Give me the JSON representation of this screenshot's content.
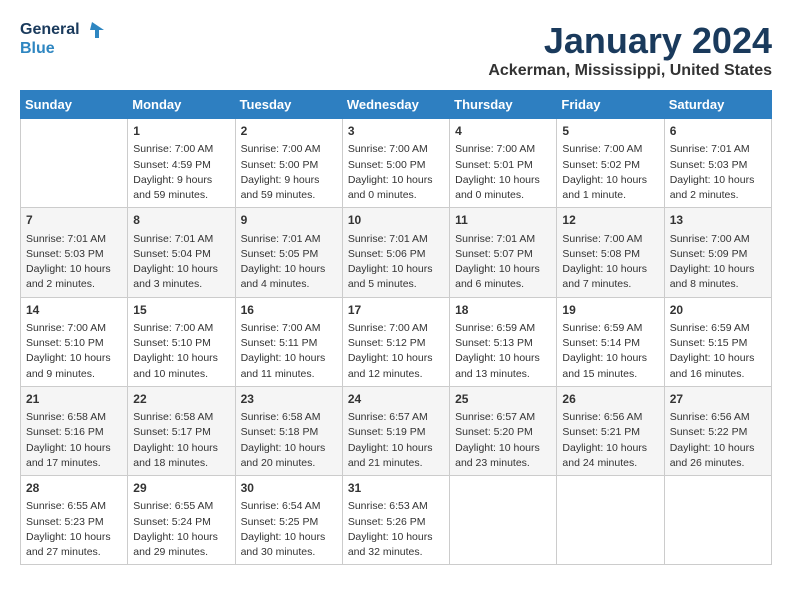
{
  "logo": {
    "text1": "General",
    "text2": "Blue"
  },
  "title": "January 2024",
  "location": "Ackerman, Mississippi, United States",
  "headers": [
    "Sunday",
    "Monday",
    "Tuesday",
    "Wednesday",
    "Thursday",
    "Friday",
    "Saturday"
  ],
  "weeks": [
    [
      {
        "day": "",
        "info": ""
      },
      {
        "day": "1",
        "info": "Sunrise: 7:00 AM\nSunset: 4:59 PM\nDaylight: 9 hours\nand 59 minutes."
      },
      {
        "day": "2",
        "info": "Sunrise: 7:00 AM\nSunset: 5:00 PM\nDaylight: 9 hours\nand 59 minutes."
      },
      {
        "day": "3",
        "info": "Sunrise: 7:00 AM\nSunset: 5:00 PM\nDaylight: 10 hours\nand 0 minutes."
      },
      {
        "day": "4",
        "info": "Sunrise: 7:00 AM\nSunset: 5:01 PM\nDaylight: 10 hours\nand 0 minutes."
      },
      {
        "day": "5",
        "info": "Sunrise: 7:00 AM\nSunset: 5:02 PM\nDaylight: 10 hours\nand 1 minute."
      },
      {
        "day": "6",
        "info": "Sunrise: 7:01 AM\nSunset: 5:03 PM\nDaylight: 10 hours\nand 2 minutes."
      }
    ],
    [
      {
        "day": "7",
        "info": "Sunrise: 7:01 AM\nSunset: 5:03 PM\nDaylight: 10 hours\nand 2 minutes."
      },
      {
        "day": "8",
        "info": "Sunrise: 7:01 AM\nSunset: 5:04 PM\nDaylight: 10 hours\nand 3 minutes."
      },
      {
        "day": "9",
        "info": "Sunrise: 7:01 AM\nSunset: 5:05 PM\nDaylight: 10 hours\nand 4 minutes."
      },
      {
        "day": "10",
        "info": "Sunrise: 7:01 AM\nSunset: 5:06 PM\nDaylight: 10 hours\nand 5 minutes."
      },
      {
        "day": "11",
        "info": "Sunrise: 7:01 AM\nSunset: 5:07 PM\nDaylight: 10 hours\nand 6 minutes."
      },
      {
        "day": "12",
        "info": "Sunrise: 7:00 AM\nSunset: 5:08 PM\nDaylight: 10 hours\nand 7 minutes."
      },
      {
        "day": "13",
        "info": "Sunrise: 7:00 AM\nSunset: 5:09 PM\nDaylight: 10 hours\nand 8 minutes."
      }
    ],
    [
      {
        "day": "14",
        "info": "Sunrise: 7:00 AM\nSunset: 5:10 PM\nDaylight: 10 hours\nand 9 minutes."
      },
      {
        "day": "15",
        "info": "Sunrise: 7:00 AM\nSunset: 5:10 PM\nDaylight: 10 hours\nand 10 minutes."
      },
      {
        "day": "16",
        "info": "Sunrise: 7:00 AM\nSunset: 5:11 PM\nDaylight: 10 hours\nand 11 minutes."
      },
      {
        "day": "17",
        "info": "Sunrise: 7:00 AM\nSunset: 5:12 PM\nDaylight: 10 hours\nand 12 minutes."
      },
      {
        "day": "18",
        "info": "Sunrise: 6:59 AM\nSunset: 5:13 PM\nDaylight: 10 hours\nand 13 minutes."
      },
      {
        "day": "19",
        "info": "Sunrise: 6:59 AM\nSunset: 5:14 PM\nDaylight: 10 hours\nand 15 minutes."
      },
      {
        "day": "20",
        "info": "Sunrise: 6:59 AM\nSunset: 5:15 PM\nDaylight: 10 hours\nand 16 minutes."
      }
    ],
    [
      {
        "day": "21",
        "info": "Sunrise: 6:58 AM\nSunset: 5:16 PM\nDaylight: 10 hours\nand 17 minutes."
      },
      {
        "day": "22",
        "info": "Sunrise: 6:58 AM\nSunset: 5:17 PM\nDaylight: 10 hours\nand 18 minutes."
      },
      {
        "day": "23",
        "info": "Sunrise: 6:58 AM\nSunset: 5:18 PM\nDaylight: 10 hours\nand 20 minutes."
      },
      {
        "day": "24",
        "info": "Sunrise: 6:57 AM\nSunset: 5:19 PM\nDaylight: 10 hours\nand 21 minutes."
      },
      {
        "day": "25",
        "info": "Sunrise: 6:57 AM\nSunset: 5:20 PM\nDaylight: 10 hours\nand 23 minutes."
      },
      {
        "day": "26",
        "info": "Sunrise: 6:56 AM\nSunset: 5:21 PM\nDaylight: 10 hours\nand 24 minutes."
      },
      {
        "day": "27",
        "info": "Sunrise: 6:56 AM\nSunset: 5:22 PM\nDaylight: 10 hours\nand 26 minutes."
      }
    ],
    [
      {
        "day": "28",
        "info": "Sunrise: 6:55 AM\nSunset: 5:23 PM\nDaylight: 10 hours\nand 27 minutes."
      },
      {
        "day": "29",
        "info": "Sunrise: 6:55 AM\nSunset: 5:24 PM\nDaylight: 10 hours\nand 29 minutes."
      },
      {
        "day": "30",
        "info": "Sunrise: 6:54 AM\nSunset: 5:25 PM\nDaylight: 10 hours\nand 30 minutes."
      },
      {
        "day": "31",
        "info": "Sunrise: 6:53 AM\nSunset: 5:26 PM\nDaylight: 10 hours\nand 32 minutes."
      },
      {
        "day": "",
        "info": ""
      },
      {
        "day": "",
        "info": ""
      },
      {
        "day": "",
        "info": ""
      }
    ]
  ]
}
